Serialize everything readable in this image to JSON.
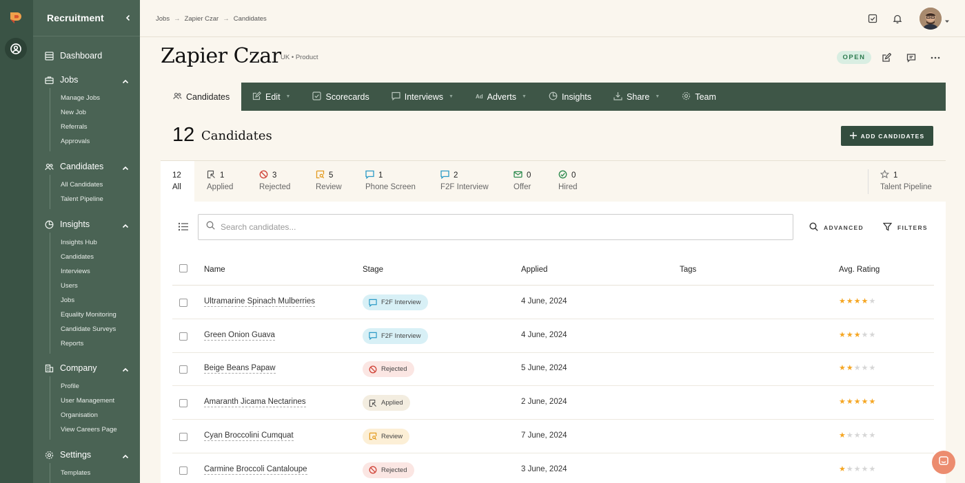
{
  "sidebar": {
    "title": "Recruitment",
    "sections": [
      {
        "label": "Dashboard",
        "icon": "dashboard-icon",
        "items": []
      },
      {
        "label": "Jobs",
        "icon": "briefcase-icon",
        "items": [
          "Manage Jobs",
          "New Job",
          "Referrals",
          "Approvals"
        ]
      },
      {
        "label": "Candidates",
        "icon": "users-icon",
        "items": [
          "All Candidates",
          "Talent Pipeline"
        ]
      },
      {
        "label": "Insights",
        "icon": "pie-chart-icon",
        "items": [
          "Insights Hub",
          "Candidates",
          "Interviews",
          "Users",
          "Jobs",
          "Equality Monitoring",
          "Candidate Surveys",
          "Reports"
        ]
      },
      {
        "label": "Company",
        "icon": "building-icon",
        "items": [
          "Profile",
          "User Management",
          "Organisation",
          "View Careers Page"
        ]
      },
      {
        "label": "Settings",
        "icon": "gear-icon",
        "items": [
          "Templates"
        ]
      }
    ]
  },
  "breadcrumb": [
    "Jobs",
    "Zapier Czar",
    "Candidates"
  ],
  "job": {
    "title": "Zapier Czar",
    "location": "UK",
    "department": "Product",
    "status": "OPEN"
  },
  "tabs": [
    {
      "label": "Candidates",
      "icon": "users-icon",
      "dropdown": false
    },
    {
      "label": "Edit",
      "icon": "edit-icon",
      "dropdown": true
    },
    {
      "label": "Scorecards",
      "icon": "check-square-icon",
      "dropdown": false
    },
    {
      "label": "Interviews",
      "icon": "chat-icon",
      "dropdown": true
    },
    {
      "label": "Adverts",
      "icon": "ad-icon",
      "dropdown": true
    },
    {
      "label": "Insights",
      "icon": "pie-chart-icon",
      "dropdown": false
    },
    {
      "label": "Share",
      "icon": "share-icon",
      "dropdown": true
    },
    {
      "label": "Team",
      "icon": "gear-icon",
      "dropdown": false
    }
  ],
  "candidates_header": {
    "count": "12",
    "label": "Candidates",
    "add_button": "ADD CANDIDATES"
  },
  "stages": [
    {
      "count": "12",
      "label": "All"
    },
    {
      "count": "1",
      "label": "Applied",
      "icon": "applied-icon",
      "color": "#555555"
    },
    {
      "count": "3",
      "label": "Rejected",
      "icon": "rejected-icon",
      "color": "#d0453a"
    },
    {
      "count": "5",
      "label": "Review",
      "icon": "review-icon",
      "color": "#e39a1d"
    },
    {
      "count": "1",
      "label": "Phone Screen",
      "icon": "phone-screen-icon",
      "color": "#2a9ac6"
    },
    {
      "count": "2",
      "label": "F2F Interview",
      "icon": "f2f-icon",
      "color": "#2a9ac6"
    },
    {
      "count": "0",
      "label": "Offer",
      "icon": "offer-icon",
      "color": "#2d8a4e"
    },
    {
      "count": "0",
      "label": "Hired",
      "icon": "hired-icon",
      "color": "#2d8a4e"
    },
    {
      "count": "1",
      "label": "Talent Pipeline",
      "icon": "star-icon",
      "color": "#777777"
    }
  ],
  "search": {
    "placeholder": "Search candidates...",
    "value": ""
  },
  "toolbar": {
    "advanced": "ADVANCED",
    "filters": "FILTERS"
  },
  "table": {
    "columns": [
      "Name",
      "Stage",
      "Applied",
      "Tags",
      "Avg. Rating"
    ],
    "rows": [
      {
        "name": "Ultramarine Spinach Mulberries",
        "stage": "F2F Interview",
        "stage_type": "f2f",
        "applied": "4 June, 2024",
        "tags": "",
        "rating": 4
      },
      {
        "name": "Green Onion Guava",
        "stage": "F2F Interview",
        "stage_type": "f2f",
        "applied": "4 June, 2024",
        "tags": "",
        "rating": 3
      },
      {
        "name": "Beige Beans Papaw",
        "stage": "Rejected",
        "stage_type": "rejected",
        "applied": "5 June, 2024",
        "tags": "",
        "rating": 2
      },
      {
        "name": "Amaranth Jicama Nectarines",
        "stage": "Applied",
        "stage_type": "applied",
        "applied": "2 June, 2024",
        "tags": "",
        "rating": 5
      },
      {
        "name": "Cyan Broccolini Cumquat",
        "stage": "Review",
        "stage_type": "review",
        "applied": "7 June, 2024",
        "tags": "",
        "rating": 1
      },
      {
        "name": "Carmine Broccoli Cantaloupe",
        "stage": "Rejected",
        "stage_type": "rejected",
        "applied": "3 June, 2024",
        "tags": "",
        "rating": 1
      }
    ]
  },
  "colors": {
    "sidebar": "#4a6354",
    "rail": "#3a5345",
    "tabbar": "#3e5647",
    "accent_button": "#334d3e",
    "star": "#f5a623",
    "background": "#faf6ee"
  }
}
